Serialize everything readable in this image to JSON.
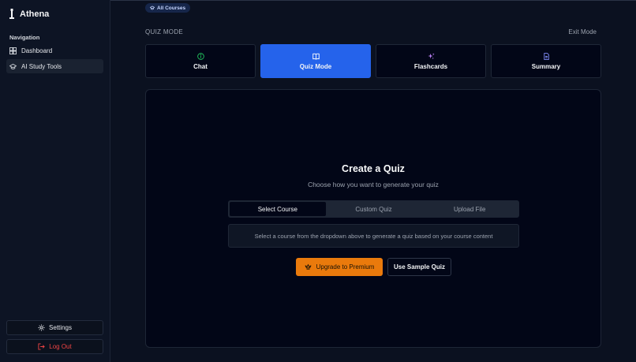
{
  "app": {
    "name": "Athena"
  },
  "sidebar": {
    "nav_title": "Navigation",
    "items": [
      {
        "label": "Dashboard",
        "icon": "dashboard-icon",
        "active": false
      },
      {
        "label": "AI Study Tools",
        "icon": "graduation-cap-icon",
        "active": true
      }
    ],
    "settings_label": "Settings",
    "logout_label": "Log Out"
  },
  "header": {
    "course_chip": "All Courses",
    "mode_label": "QUIZ MODE",
    "exit_label": "Exit Mode"
  },
  "tabs": [
    {
      "label": "Chat",
      "icon": "chat-info-icon",
      "active": false
    },
    {
      "label": "Quiz Mode",
      "icon": "book-icon",
      "active": true
    },
    {
      "label": "Flashcards",
      "icon": "sparkles-icon",
      "active": false
    },
    {
      "label": "Summary",
      "icon": "document-icon",
      "active": false
    }
  ],
  "quiz": {
    "title": "Create a Quiz",
    "subtitle": "Choose how you want to generate your quiz",
    "options": [
      "Select Course",
      "Custom Quiz",
      "Upload File"
    ],
    "selected_option": "Select Course",
    "info_text": "Select a course from the dropdown above to generate a quiz based on your course content",
    "premium_label": "Upgrade to Premium",
    "sample_label": "Use Sample Quiz"
  },
  "colors": {
    "background": "#0b1120",
    "accent": "#2563eb",
    "premium": "#ea7a0c",
    "danger": "#ef4444",
    "chat_icon": "#22c55e",
    "flashcards_icon": "#c084fc",
    "summary_icon": "#818cf8"
  }
}
